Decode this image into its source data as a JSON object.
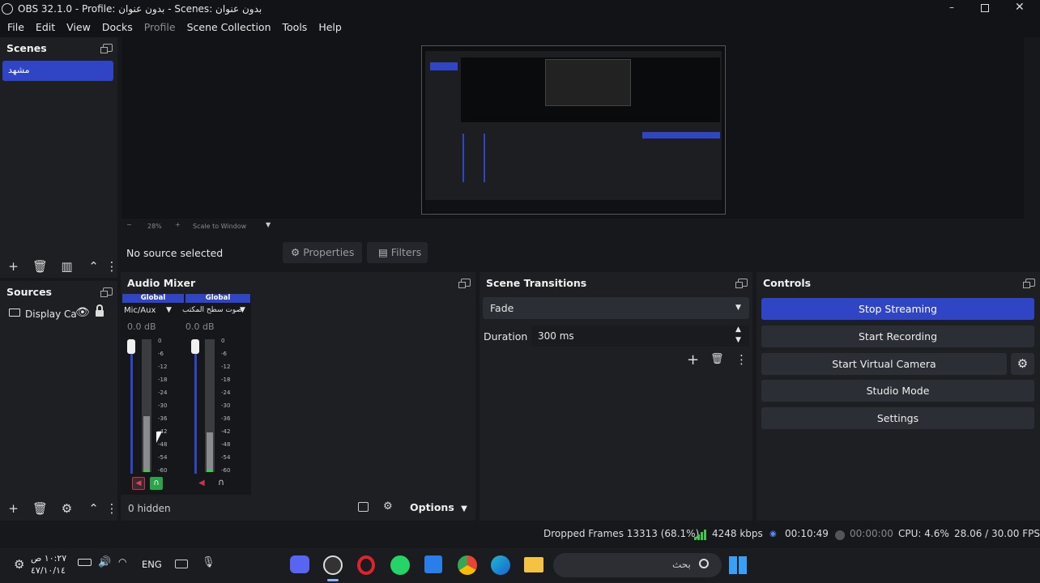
{
  "window": {
    "title": "OBS 32.1.0 - Profile: بدون عنوان - Scenes: بدون عنوان"
  },
  "menu": [
    "File",
    "Edit",
    "View",
    "Docks",
    "Profile",
    "Scene Collection",
    "Tools",
    "Help"
  ],
  "scenes": {
    "title": "Scenes",
    "items": [
      "مشهد"
    ]
  },
  "preview": {
    "zoom": "28%",
    "scale_mode": "Scale to Window"
  },
  "source_bar": {
    "status": "No source selected",
    "properties": "Properties",
    "filters": "Filters"
  },
  "sources": {
    "title": "Sources",
    "items": [
      {
        "name": "Display Ca"
      }
    ]
  },
  "mixer": {
    "title": "Audio Mixer",
    "channels": [
      {
        "badge": "Global",
        "name": "Mic/Aux",
        "db": "0.0 dB",
        "level": 0.42
      },
      {
        "badge": "Global",
        "name": "صوت سطح المكتب",
        "db": "0.0 dB",
        "level": 0.3
      }
    ],
    "scale": [
      "0",
      "-6",
      "-12",
      "-18",
      "-24",
      "-30",
      "-36",
      "-42",
      "-48",
      "-54",
      "-60"
    ],
    "hidden": "0 hidden",
    "options": "Options"
  },
  "transitions": {
    "title": "Scene Transitions",
    "selected": "Fade",
    "duration_label": "Duration",
    "duration_value": "300 ms"
  },
  "controls": {
    "title": "Controls",
    "stop_streaming": "Stop Streaming",
    "start_recording": "Start Recording",
    "start_virtual_camera": "Start Virtual Camera",
    "studio_mode": "Studio Mode",
    "settings": "Settings"
  },
  "status": {
    "dropped": "Dropped Frames 13313 (68.1%)",
    "bitrate": "4248 kbps",
    "stream_time": "00:10:49",
    "rec_time": "00:00:00",
    "cpu": "CPU: 4.6%",
    "fps": "28.06 / 30.00 FPS"
  },
  "taskbar": {
    "time": "١٠:٢٧ ص",
    "date": "٤٧/١٠/١٤",
    "lang": "ENG",
    "search": "بحث"
  },
  "colors": {
    "accent": "#2f45c6",
    "panel": "#1d1f23",
    "background": "#17181c"
  }
}
